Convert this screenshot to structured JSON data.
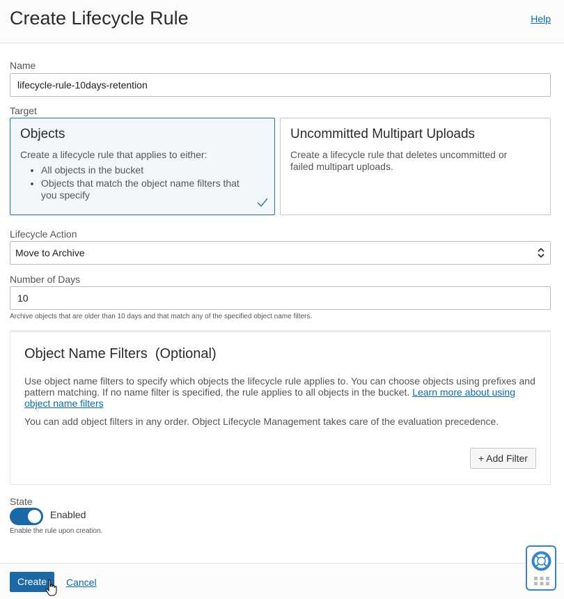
{
  "header": {
    "title": "Create Lifecycle Rule",
    "help": "Help"
  },
  "name_field": {
    "label": "Name",
    "value": "lifecycle-rule-10days-retention"
  },
  "target": {
    "label": "Target",
    "options": [
      {
        "title": "Objects",
        "description": "Create a lifecycle rule that applies to either:",
        "bullets": [
          "All objects in the bucket",
          "Objects that match the object name filters that you specify"
        ],
        "selected": true
      },
      {
        "title": "Uncommitted Multipart Uploads",
        "description": "Create a lifecycle rule that deletes uncommitted or failed multipart uploads.",
        "selected": false
      }
    ]
  },
  "lifecycle_action": {
    "label": "Lifecycle Action",
    "value": "Move to Archive"
  },
  "days": {
    "label": "Number of Days",
    "value": "10",
    "hint": "Archive objects that are older than 10 days and that match any of the specified object name filters."
  },
  "filters": {
    "title": "Object Name Filters",
    "optional": "(Optional)",
    "description": "Use object name filters to specify which objects the lifecycle rule applies to. You can choose objects using prefixes and pattern matching. If no name filter is specified, the rule applies to all objects in the bucket.",
    "link": "Learn more about using object name filters",
    "note": "You can add object filters in any order. Object Lifecycle Management takes care of the evaluation precedence.",
    "add_button": "+ Add Filter"
  },
  "state": {
    "label": "State",
    "toggle_label": "Enabled",
    "hint": "Enable the rule upon creation.",
    "enabled": true
  },
  "footer": {
    "create": "Create",
    "cancel": "Cancel"
  },
  "colors": {
    "accent": "#1c69a8",
    "link": "#0d6aa8",
    "selected_bg": "#f2f7fc"
  },
  "icons": {
    "check": "check-icon",
    "select_arrows": "updown-chevron-icon",
    "support": "lifebuoy-icon",
    "cursor": "hand-pointer-icon"
  }
}
